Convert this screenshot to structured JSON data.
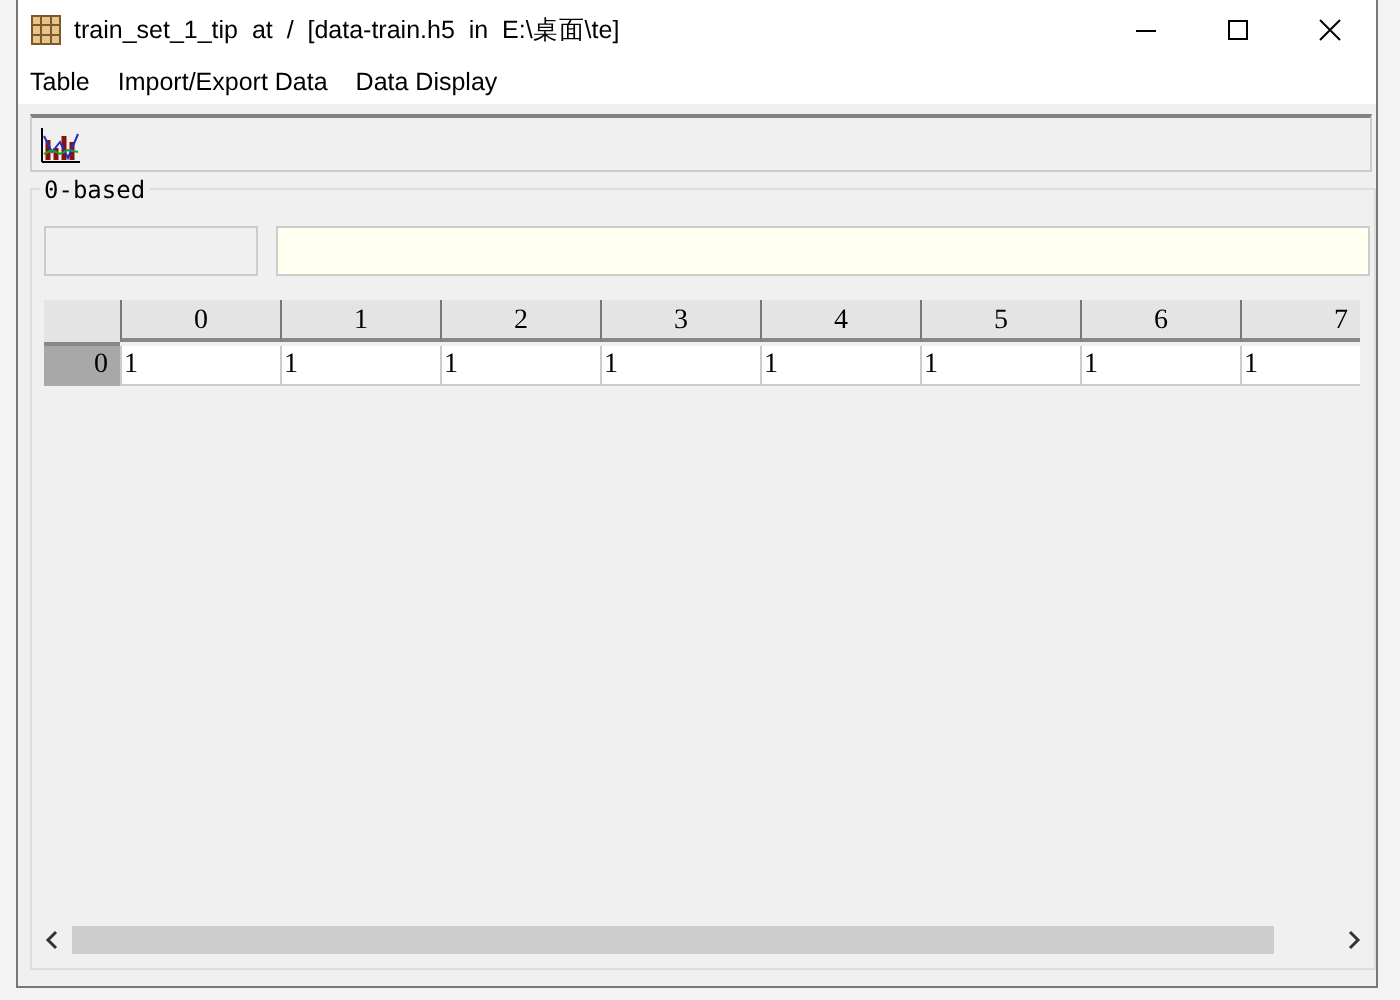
{
  "window": {
    "title": "train_set_1_tip  at  /  [data-train.h5  in  E:\\桌面\\te]"
  },
  "menu": [
    "Table",
    "Import/Export Data",
    "Data Display"
  ],
  "group": {
    "label": "0-based"
  },
  "table": {
    "columns": [
      "0",
      "1",
      "2",
      "3",
      "4",
      "5",
      "6",
      "7"
    ],
    "rows": [
      {
        "header": "0",
        "selected": true,
        "cells": [
          "1",
          "1",
          "1",
          "1",
          "1",
          "1",
          "1",
          "1"
        ]
      }
    ]
  }
}
